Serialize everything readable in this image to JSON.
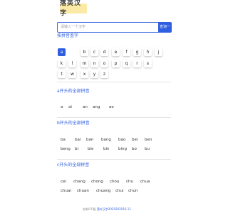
{
  "header": {
    "logo_text": "落英汉字"
  },
  "search": {
    "placeholder": "请输入一个汉字",
    "button_label": "查询一下"
  },
  "alphabet": {
    "heading": "按拼音查字",
    "letters": [
      "a",
      "b",
      "c",
      "d",
      "e",
      "f",
      "g",
      "h",
      "j",
      "k",
      "l",
      "m",
      "n",
      "o",
      "p",
      "q",
      "r",
      "s",
      "t",
      "w",
      "x",
      "y",
      "z"
    ],
    "active": "a"
  },
  "sections": [
    {
      "heading": "a开头的全部拼音",
      "items": [
        "a",
        "ai",
        "an",
        "ang",
        "ao"
      ]
    },
    {
      "heading": "b开头的全部拼音",
      "items": [
        "ba",
        "bai",
        "ban",
        "bang",
        "bao",
        "bei",
        "ben",
        "beng",
        "bi",
        "bie",
        "bin",
        "bing",
        "bo",
        "bu"
      ]
    },
    {
      "heading": "c开头的全部拼音",
      "items": [
        "cei",
        "chang",
        "chong",
        "chou",
        "chu",
        "chua",
        "chuai",
        "chuan",
        "chuang",
        "chui",
        "chun"
      ]
    }
  ],
  "footer": {
    "prefix": "苏新ICP备",
    "link": "落叶汉字2020202016-11"
  }
}
